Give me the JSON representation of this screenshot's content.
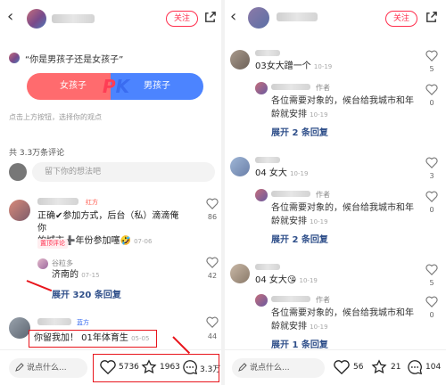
{
  "left": {
    "follow_label": "关注",
    "question": "“你是男孩子还是女孩子”",
    "pk": {
      "left_option": "女孩子",
      "right_option": "男孩子",
      "p": "P",
      "k": "K"
    },
    "hint": "点击上方按钮，选择你的观点",
    "comment_count": "共 3.3万条评论",
    "input_placeholder": "留下你的想法吧",
    "comments": [
      {
        "side_tag": "红方",
        "text_line1": "正确✔参加方式，后台（私）滴滴俺你",
        "text_line2": "的城市➕年份参加噻🤣",
        "date": "07-06",
        "badge": "置顶评论",
        "likes": "86",
        "reply": {
          "name": "谷粒多",
          "text": "济南的",
          "date": "07-15",
          "likes": "42"
        },
        "expand": "展开 320 条回复"
      },
      {
        "side_tag": "蓝方",
        "text": "你留我加！ 01年体育生",
        "date": "05-05",
        "likes": "44"
      }
    ],
    "bottom": {
      "say": "说点什么...",
      "likes": "5736",
      "stars": "1963",
      "comments": "3.3万"
    }
  },
  "right": {
    "follow_label": "关注",
    "threads": [
      {
        "name": "03女大蹭一个",
        "date": "10-19",
        "likes": "5",
        "author_tag": "作者",
        "author_text_line1": "各位需要对象的，候台给我城市和年",
        "author_text_line2": "龄就安排",
        "author_date": "10-19",
        "author_likes": "0",
        "expand": "展开 2 条回复"
      },
      {
        "name": "04 女大",
        "date": "10-19",
        "likes": "3",
        "author_tag": "作者",
        "author_text_line1": "各位需要对象的，候台给我城市和年",
        "author_text_line2": "龄就安排",
        "author_date": "10-19",
        "author_likes": "0",
        "expand": "展开 2 条回复"
      },
      {
        "name": "04 女大😘",
        "date": "10-19",
        "likes": "5",
        "author_tag": "作者",
        "author_text_line1": "各位需要对象的，候台给我城市和年",
        "author_text_line2": "龄就安排",
        "author_date": "10-19",
        "author_likes": "0",
        "expand": "展开 1 条回复"
      }
    ],
    "bottom": {
      "say": "说点什么...",
      "likes": "56",
      "stars": "21",
      "comments": "104"
    }
  },
  "icons": {
    "back": "chevron-left-icon",
    "share": "share-icon",
    "heart": "heart-icon",
    "star": "star-icon",
    "comment": "comment-bubble-icon",
    "pen": "pen-icon"
  },
  "colors": {
    "accent_red": "#ff2e4d",
    "pk_pink": "#ff6b6e",
    "pk_blue": "#4c84ff",
    "link_blue": "#2f4f8a",
    "annotation_red": "#e8151c"
  }
}
